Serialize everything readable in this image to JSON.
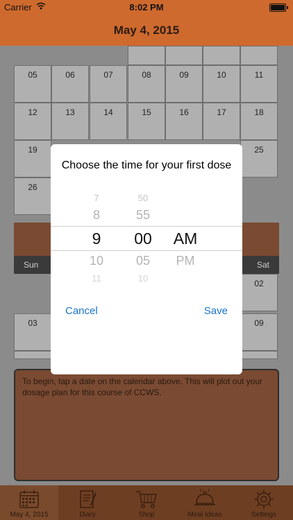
{
  "status_bar": {
    "carrier": "Carrier",
    "time": "8:02 PM"
  },
  "nav": {
    "title": "May 4, 2015"
  },
  "calendar": {
    "row1": [
      "05",
      "06",
      "07",
      "08",
      "09",
      "10",
      "11"
    ],
    "row2": [
      "12",
      "13",
      "14",
      "15",
      "16",
      "17",
      "18"
    ],
    "row3": [
      "19",
      "25"
    ],
    "row4": [
      "26"
    ],
    "weekdays": [
      "Sun",
      "Sat"
    ],
    "row5": [
      "02"
    ],
    "row6": [
      "03",
      "09"
    ]
  },
  "info": {
    "text": "To begin, tap a date on the calendar above. This will plot out your dosage plan for this course of CCWS."
  },
  "modal": {
    "title": "Choose the time for your first dose",
    "hours": [
      "7",
      "8",
      "9",
      "10",
      "11"
    ],
    "minutes": [
      "50",
      "55",
      "00",
      "05",
      "10"
    ],
    "periods": [
      "AM",
      "PM"
    ],
    "cancel": "Cancel",
    "save": "Save"
  },
  "tabs": [
    {
      "label": "May 4, 2015",
      "icon": "calendar-icon",
      "active": true
    },
    {
      "label": "Diary",
      "icon": "notepad-icon"
    },
    {
      "label": "Shop",
      "icon": "cart-icon"
    },
    {
      "label": "Meal Ideas",
      "icon": "cloche-icon"
    },
    {
      "label": "Settings",
      "icon": "gear-icon"
    }
  ]
}
